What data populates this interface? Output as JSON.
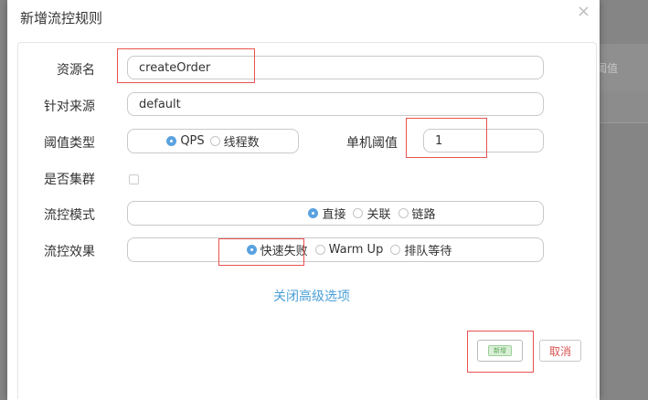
{
  "background": {
    "column_text": "阈值"
  },
  "modal": {
    "title": "新增流控规则",
    "close_glyph": "×",
    "fields": {
      "resource": {
        "label": "资源名",
        "value": "createOrder"
      },
      "origin": {
        "label": "针对来源",
        "value": "default"
      },
      "grade": {
        "label": "阈值类型",
        "options": [
          "QPS",
          "线程数"
        ],
        "selected": "QPS"
      },
      "count": {
        "label": "单机阈值",
        "value": "1"
      },
      "cluster": {
        "label": "是否集群",
        "checked": false
      },
      "strategy": {
        "label": "流控模式",
        "options": [
          "直接",
          "关联",
          "链路"
        ],
        "selected": "直接"
      },
      "control_behavior": {
        "label": "流控效果",
        "options": [
          "快速失败",
          "Warm Up",
          "排队等待"
        ],
        "selected": "快速失败"
      }
    },
    "advanced_toggle": "关闭高级选项",
    "buttons": {
      "save": "新增",
      "cancel": "取消"
    }
  },
  "colors": {
    "accent": "#4a9fd6",
    "radio_checked": "#5aa2e0",
    "highlight_box": "#e8534f",
    "save_green": "#57b957",
    "cancel_red": "#d9534f"
  }
}
